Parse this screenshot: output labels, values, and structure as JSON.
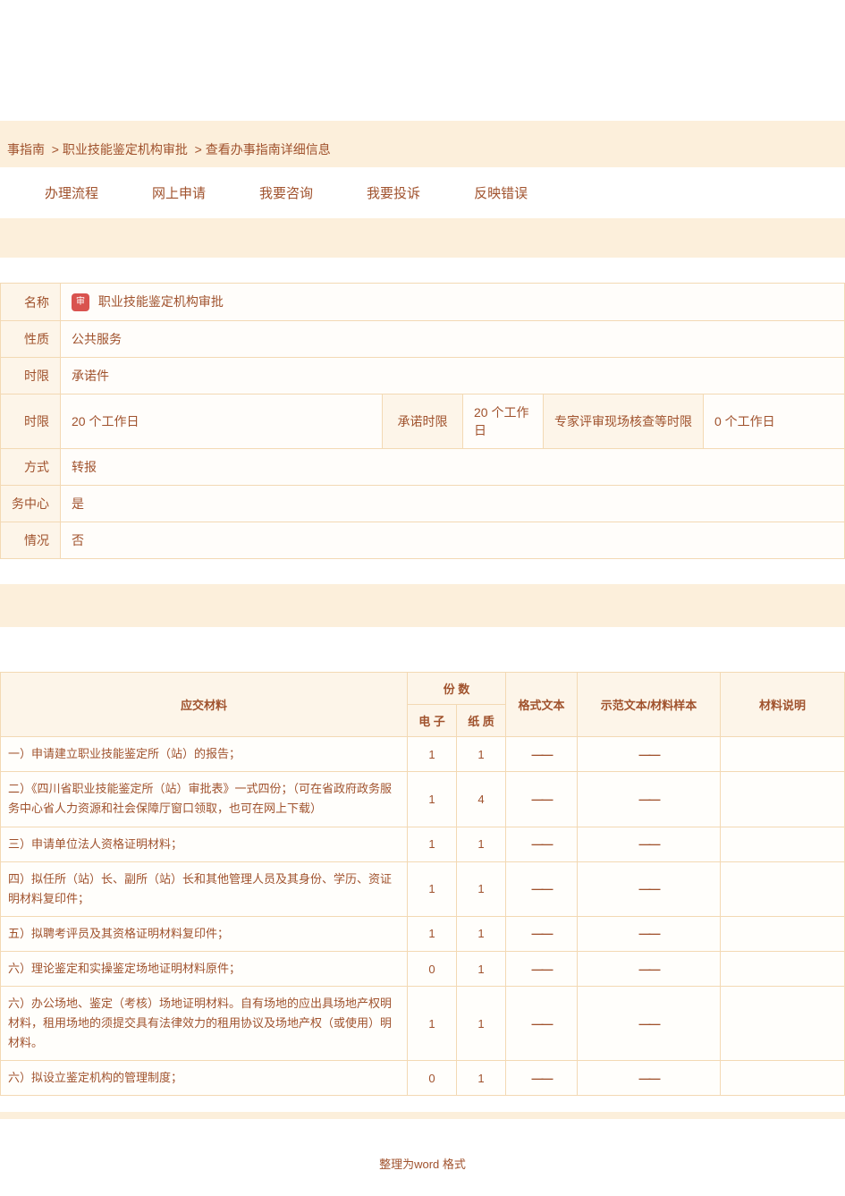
{
  "breadcrumb": {
    "part1": "事指南",
    "sep1": ">",
    "part2": "职业技能鉴定机构审批",
    "sep2": ">",
    "part3": "查看办事指南详细信息"
  },
  "tabs": {
    "t1": "办理流程",
    "t2": "网上申请",
    "t3": "我要咨询",
    "t4": "我要投诉",
    "t5": "反映错误"
  },
  "badge_text": "审",
  "info": {
    "name_label": "名称",
    "name_value": "职业技能鉴定机构审批",
    "nature_label": "性质",
    "nature_value": "公共服务",
    "limit1_label": "时限",
    "limit1_value": "承诺件",
    "limit2_label": "时限",
    "legal_limit_value": "20 个工作日",
    "promise_label": "承诺时限",
    "promise_value": "20 个工作日",
    "expert_label": "专家评审现场核查等时限",
    "expert_value": "0 个工作日",
    "method_label": "方式",
    "method_value": "转报",
    "center_label": "务中心",
    "center_value": "是",
    "status_label": "情况",
    "status_value": "否"
  },
  "materials_header": {
    "docs": "应交材料",
    "copies": "份 数",
    "elec": "电 子",
    "paper": "纸 质",
    "format": "格式文本",
    "sample": "示范文本/材料样本",
    "note": "材料说明"
  },
  "materials": [
    {
      "desc": "一）申请建立职业技能鉴定所（站）的报告；",
      "e": "1",
      "p": "1"
    },
    {
      "desc": "二）《四川省职业技能鉴定所（站）审批表》一式四份；（可在省政府政务服务中心省人力资源和社会保障厅窗口领取，也可在网上下载）",
      "e": "1",
      "p": "4"
    },
    {
      "desc": "三）申请单位法人资格证明材料；",
      "e": "1",
      "p": "1"
    },
    {
      "desc": "四）拟任所（站）长、副所（站）长和其他管理人员及其身份、学历、资证明材料复印件；",
      "e": "1",
      "p": "1"
    },
    {
      "desc": "五）拟聘考评员及其资格证明材料复印件；",
      "e": "1",
      "p": "1"
    },
    {
      "desc": "六）理论鉴定和实操鉴定场地证明材料原件；",
      "e": "0",
      "p": "1"
    },
    {
      "desc": "六）办公场地、鉴定（考核）场地证明材料。自有场地的应出具场地产权明材料，租用场地的须提交具有法律效力的租用协议及场地产权（或使用）明材料。",
      "e": "1",
      "p": "1"
    },
    {
      "desc": "六）拟设立鉴定机构的管理制度；",
      "e": "0",
      "p": "1"
    }
  ],
  "dash": "——",
  "footer": "整理为word 格式"
}
